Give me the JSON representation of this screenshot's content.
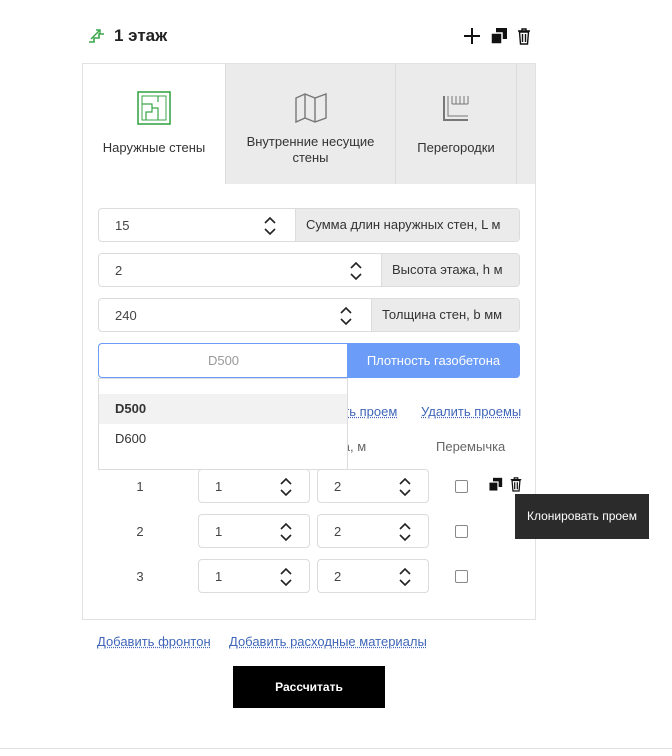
{
  "header": {
    "floor_title": "1 этаж",
    "icons": [
      "stairs-icon",
      "plus-icon",
      "clone-icon",
      "trash-icon"
    ]
  },
  "tabs": [
    {
      "label": "Наружные стены",
      "active": true,
      "icon": "outer-walls-icon"
    },
    {
      "label": "Внутренние несущие стены",
      "active": false,
      "icon": "inner-walls-icon"
    },
    {
      "label": "Перегородки",
      "active": false,
      "icon": "partitions-icon"
    }
  ],
  "fields": [
    {
      "value": "15",
      "label": "Сумма длин наружных стен, L м"
    },
    {
      "value": "2",
      "label": "Высота этажа, h м"
    },
    {
      "value": "240",
      "label": "Толщина стен, b мм"
    }
  ],
  "density": {
    "placeholder": "D500",
    "label": "Плотность газобетона",
    "options": [
      "D500",
      "D600"
    ],
    "highlighted": "D500"
  },
  "openings": {
    "add_link": "ить проем",
    "delete_link": "Удалить проемы",
    "col_height": "та, м",
    "col_lintel": "Перемычка",
    "rows": [
      {
        "num": "1",
        "width": "1",
        "height": "2",
        "lintel": false
      },
      {
        "num": "2",
        "width": "1",
        "height": "2",
        "lintel": false
      },
      {
        "num": "3",
        "width": "1",
        "height": "2",
        "lintel": false
      }
    ],
    "tooltip": "Клонировать проем"
  },
  "footer": {
    "add_gable": "Добавить фронтон",
    "add_materials": "Добавить расходные материалы",
    "calculate": "Рассчитать"
  },
  "colors": {
    "accent": "#6b9cf7",
    "icon_green": "#3aa64a",
    "link": "#3f66b8"
  }
}
